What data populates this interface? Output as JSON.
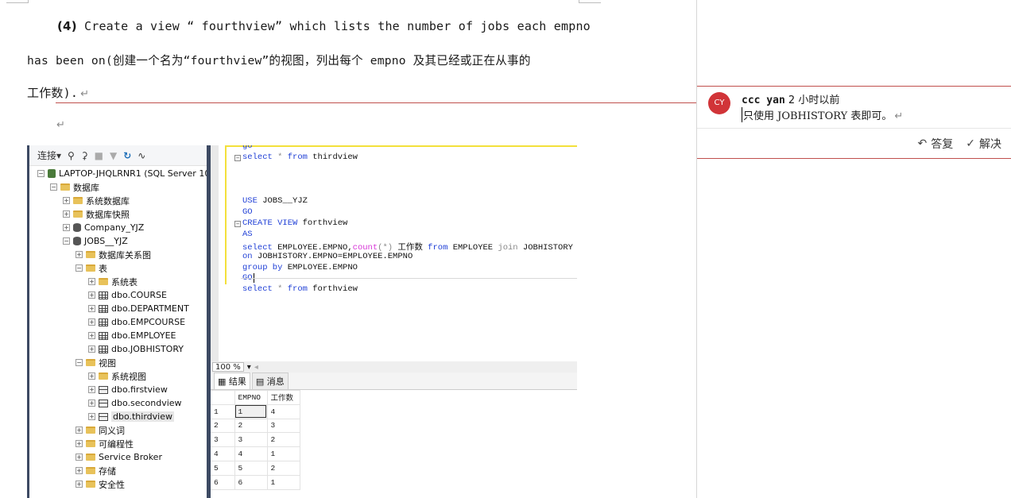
{
  "document": {
    "para_line1_num": "(4)",
    "para_line1_text": " Create a view “ fourthview” which lists the number of jobs each empno",
    "para_line2": "has been on(创建一个名为“fourthview”的视图，列出每个 empno 及其已经或正在从事的",
    "para_line3": "工作数).",
    "para_mark": "↵"
  },
  "ssms": {
    "toolbar": {
      "connect": "连接▾"
    },
    "tree": {
      "server": "LAPTOP-JHQLRNR1 (SQL Server 10",
      "databases": "数据库",
      "system_dbs": "系统数据库",
      "db_snapshots": "数据库快照",
      "company_db": "Company_YJZ",
      "jobs_db": "JOBS__YJZ",
      "db_diagrams": "数据库关系图",
      "tables": "表",
      "system_tables": "系统表",
      "t_course": "dbo.COURSE",
      "t_department": "dbo.DEPARTMENT",
      "t_empcourse": "dbo.EMPCOURSE",
      "t_employee": "dbo.EMPLOYEE",
      "t_jobhistory": "dbo.JOBHISTORY",
      "views": "视图",
      "system_views": "系统视图",
      "v_first": "dbo.firstview",
      "v_second": "dbo.secondview",
      "v_third": "dbo.thirdview",
      "synonyms": "同义词",
      "programmability": "可编程性",
      "service_broker": "Service Broker",
      "storage": "存储",
      "security": "安全性"
    },
    "editor": {
      "l0": "go",
      "l1_kw": "select",
      "l1_rest": " * ",
      "l1_from": "from",
      "l1_obj": " thirdview",
      "l2_kw": "USE",
      "l2_obj": " JOBS__YJZ",
      "l3": "GO",
      "l4_kw": "CREATE VIEW",
      "l4_obj": " forthview",
      "l5": "AS",
      "l6_kw": "select",
      "l6_a": " EMPLOYEE.EMPNO,",
      "l6_fn": "count",
      "l6_b": "(*)",
      "l6_c": " 工作数 ",
      "l6_from": "from",
      "l6_d": " EMPLOYEE ",
      "l6_join": "join",
      "l6_e": " JOBHISTORY",
      "l7_kw": "on",
      "l7_rest": " JOBHISTORY.EMPNO=EMPLOYEE.EMPNO",
      "l8_kw": "group by",
      "l8_rest": " EMPLOYEE.EMPNO",
      "l9": "GO",
      "l10_kw": "select",
      "l10_rest": " * ",
      "l10_from": "from",
      "l10_obj": " forthview"
    },
    "zoom": "100 %",
    "results_tab": "结果",
    "messages_tab": "消息",
    "results": {
      "columns": [
        "EMPNO",
        "工作数"
      ],
      "rows": [
        [
          "1",
          "1",
          "4"
        ],
        [
          "2",
          "2",
          "3"
        ],
        [
          "3",
          "3",
          "2"
        ],
        [
          "4",
          "4",
          "1"
        ],
        [
          "5",
          "5",
          "2"
        ],
        [
          "6",
          "6",
          "1"
        ]
      ]
    }
  },
  "comment": {
    "avatar": "CY",
    "author": "ccc yan",
    "time": " 2 小时以前",
    "text": "只使用 JOBHISTORY 表即可。",
    "reply": "答复",
    "resolve": "解决"
  }
}
